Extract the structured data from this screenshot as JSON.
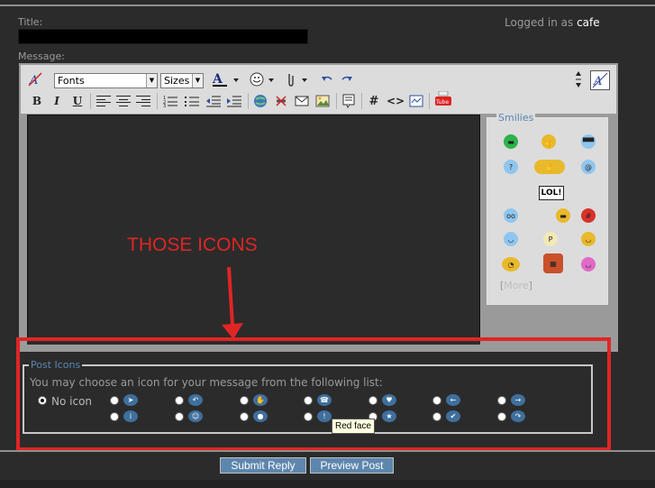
{
  "title_label": "Title:",
  "logged_in": {
    "prefix": "Logged in as",
    "user": "cafe"
  },
  "message_label": "Message:",
  "toolbar": {
    "fonts_value": "Fonts",
    "sizes_value": "Sizes",
    "bold": "B",
    "italic": "I",
    "underline": "U",
    "hash": "#",
    "code": "<>"
  },
  "smilies": {
    "legend": "Smilies",
    "more": "More",
    "lol_sign": "LOL!"
  },
  "annotation": {
    "text": "THOSE ICONS"
  },
  "post_icons": {
    "legend": "Post Icons",
    "instruction": "You may choose an icon for your message from the following list:",
    "no_icon_label": "No icon"
  },
  "tooltip": "Red face",
  "buttons": {
    "submit": "Submit Reply",
    "preview": "Preview Post"
  },
  "colors": {
    "annotation_red": "#e02525",
    "accent_blue": "#5a86b4",
    "button_blue": "#5e86ad"
  }
}
